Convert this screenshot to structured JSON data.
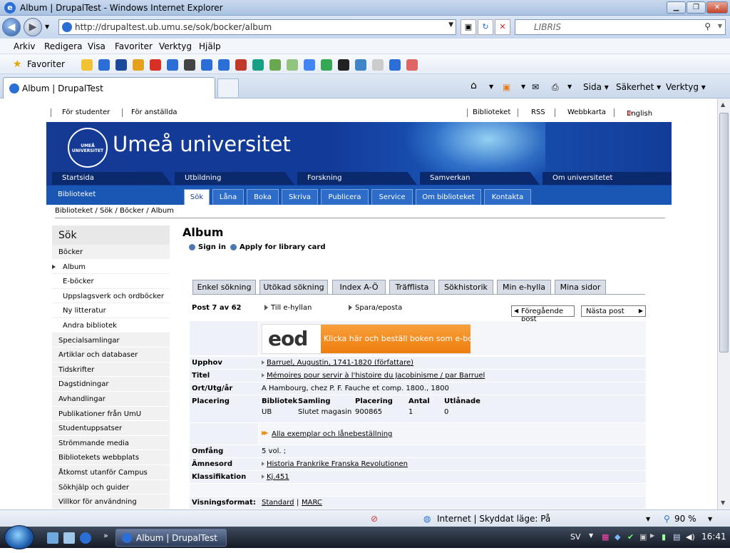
{
  "window": {
    "title": "Album | DrupalTest - Windows Internet Explorer"
  },
  "address": {
    "url": "http://drupaltest.ub.umu.se/sok/bocker/album",
    "search_placeholder": "LIBRIS"
  },
  "menu": [
    "Arkiv",
    "Redigera",
    "Visa",
    "Favoriter",
    "Verktyg",
    "Hjälp"
  ],
  "favorites": {
    "label": "Favoriter"
  },
  "tab": {
    "title": "Album | DrupalTest"
  },
  "commandbar": {
    "sida": "Sida",
    "sakerhet": "Säkerhet",
    "verktyg": "Verktyg"
  },
  "page": {
    "topnav_left": [
      "För studenter",
      "För anställda"
    ],
    "topnav_right": [
      "Biblioteket",
      "RSS",
      "Webbkarta",
      "English"
    ],
    "university": "Umeå universitet",
    "seal": "UMEÅ UNIVERSITET",
    "main_tabs": [
      "Startsida",
      "Utbildning",
      "Forskning",
      "Samverkan",
      "Om universitetet"
    ],
    "sub_label": "Biblioteket",
    "sub_tabs": [
      "Sök",
      "Låna",
      "Boka",
      "Skriva",
      "Publicera",
      "Service",
      "Om biblioteket",
      "Kontakta"
    ],
    "breadcrumb": "Biblioteket / Sök / Böcker / Album",
    "sidebar": {
      "heading": "Sök",
      "items": [
        {
          "label": "Böcker",
          "sub": false
        },
        {
          "label": "Album",
          "sub": true,
          "current": true
        },
        {
          "label": "E-böcker",
          "sub": true
        },
        {
          "label": "Uppslagsverk och ordböcker",
          "sub": true
        },
        {
          "label": "Ny litteratur",
          "sub": true
        },
        {
          "label": "Andra bibliotek",
          "sub": true
        },
        {
          "label": "Specialsamlingar",
          "sub": false
        },
        {
          "label": "Artiklar och databaser",
          "sub": false
        },
        {
          "label": "Tidskrifter",
          "sub": false
        },
        {
          "label": "Dagstidningar",
          "sub": false
        },
        {
          "label": "Avhandlingar",
          "sub": false
        },
        {
          "label": "Publikationer från UmU",
          "sub": false
        },
        {
          "label": "Studentuppsatser",
          "sub": false
        },
        {
          "label": "Strömmande media",
          "sub": false
        },
        {
          "label": "Bibliotekets webbplats",
          "sub": false
        },
        {
          "label": "Åtkomst utanför Campus",
          "sub": false
        },
        {
          "label": "Sökhjälp och guider",
          "sub": false
        },
        {
          "label": "Villkor för användning",
          "sub": false
        }
      ]
    },
    "content": {
      "title": "Album",
      "sign_in": "Sign in",
      "apply": "Apply for library card",
      "search_tabs": [
        "Enkel sökning",
        "Utökad sökning",
        "Index A-Ö",
        "Träfflista",
        "Sökhistorik",
        "Min e-hylla",
        "Mina sidor"
      ],
      "post": "Post 7 av 62",
      "till_ehyllan": "Till e-hyllan",
      "spara": "Spara/eposta",
      "prev": "Föregående post",
      "next": "Nästa post",
      "eod_logo": "eod",
      "eod_cta": "Klicka här och beställ boken som e-bok!",
      "record": {
        "upphov_label": "Upphov",
        "upphov": "Barruel, Augustin, 1741-1820 (författare)",
        "titel_label": "Titel",
        "titel": "Mémoires pour servir à l'histoire du Jacobinisme / par Barruel",
        "ort_label": "Ort/Utg/år",
        "ort": "A Hambourg, chez P. F. Fauche et comp. 1800., 1800",
        "placering_label": "Placering",
        "holdings_headers": [
          "Bibliotek",
          "Samling",
          "Placering",
          "Antal",
          "Utlånade"
        ],
        "holdings_row": [
          "UB",
          "Slutet magasin",
          "900865",
          "1",
          "0"
        ],
        "alla": "Alla exemplar och lånebeställning",
        "omfang_label": "Omfång",
        "omfang": "5 vol. ;",
        "amnesord_label": "Ämnesord",
        "amnesord": "Historia Frankrike Franska Revolutionen",
        "klass_label": "Klassifikation",
        "klass": "Kj.451",
        "visning_label": "Visningsformat:",
        "standard": "Standard",
        "marc": "MARC",
        "visning_sep": "|"
      }
    }
  },
  "status": {
    "zone": "Internet | Skyddat läge: På",
    "zoom": "90 %"
  },
  "taskbar": {
    "task": "Album | DrupalTest ...",
    "lang": "SV",
    "clock": "16:41"
  }
}
